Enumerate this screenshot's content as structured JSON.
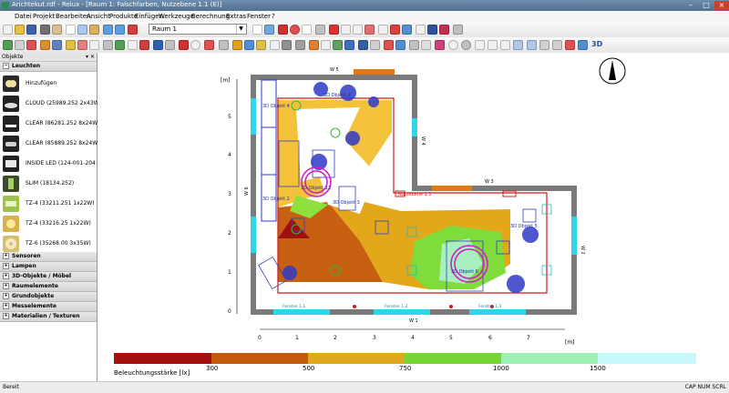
{
  "window": {
    "title": "Arichtekut.rdf - Relux - [Raum 1: Falschfarben, Nutzebene 1.1 (E)]",
    "minimize": "–",
    "maximize": "□",
    "close": "×"
  },
  "menu": [
    "Datei",
    "Projekt",
    "Bearbeiten",
    "Ansicht",
    "Produkte",
    "Einfügen",
    "Werkzeuge",
    "Berechnung",
    "Extras",
    "Fenster",
    "?"
  ],
  "toolbar": {
    "room_select": "Raum 1",
    "view3d": "3D"
  },
  "sidebar": {
    "header": "Objekte",
    "header_controls": "▾ ✕",
    "active_section": "Leuchten",
    "lamps": [
      {
        "label": "Hinzufügen",
        "icon": "add-lamp-icon"
      },
      {
        "label": "CLOUD (25989.252 2x43W)",
        "icon": "cloud-lamp-icon"
      },
      {
        "label": "CLEAR (86281.252 8x24W)",
        "icon": "clear-lamp-icon"
      },
      {
        "label": "CLEAR (85889.252 8x24W)",
        "icon": "clear-lamp-icon"
      },
      {
        "label": "INSIDE LED (124-001-204 )",
        "icon": "inside-led-icon"
      },
      {
        "label": "SLIM (18134.252)",
        "icon": "slim-lamp-icon"
      },
      {
        "label": "TZ-4 (33211.251 1x22W)",
        "icon": "tz4-lamp-icon"
      },
      {
        "label": "TZ-4 (33216.25 1x22W)",
        "icon": "tz4-lamp-icon"
      },
      {
        "label": "TZ-6 (35268.00 3x35W)",
        "icon": "tz6-lamp-icon"
      }
    ],
    "sections": [
      "Sensoren",
      "Lampen",
      "3D-Objekte / Möbel",
      "Raumelemente",
      "Grundobjekte",
      "Messelemente",
      "Materialien / Texturen"
    ]
  },
  "plan": {
    "axis_unit": "[m]",
    "x_ticks": [
      "0",
      "1",
      "2",
      "3",
      "4",
      "5",
      "6",
      "7"
    ],
    "y_ticks": [
      "0",
      "1",
      "2",
      "3",
      "4",
      "5"
    ],
    "wall_labels": {
      "top": "W 5",
      "right_upper": "W 4",
      "mid": "W 3",
      "right": "W 2",
      "bottom": "W 1",
      "left": "W 6"
    },
    "workplane_label": "Nutzebene 1.1",
    "object_labels": [
      "3D Objekt 4",
      "3D Objekt 9",
      "3D Objekt 2",
      "3D Objekt 13",
      "3D Objekt 3",
      "3D Objekt 6",
      "3D Objekt 5"
    ],
    "window_labels": [
      "Fenster 1.1",
      "Fenster 1.2",
      "Fenster 1.3"
    ]
  },
  "legend": {
    "title": "Beleuchtungsstärke [lx]",
    "values": [
      "300",
      "500",
      "750",
      "1000",
      "1500"
    ],
    "colors": [
      "#a51010",
      "#c35a0c",
      "#e0a81e",
      "#78d632",
      "#9cf0b4",
      "#c8fafa"
    ]
  },
  "status": {
    "left": "Bereit",
    "right": "CAP  NUM  SCRL"
  }
}
